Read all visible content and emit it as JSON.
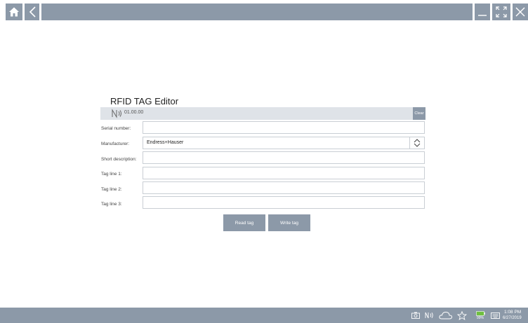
{
  "app": {
    "title": "RFID TAG Editor"
  },
  "header": {
    "version": "01.00.00",
    "clear_label": "Clear"
  },
  "form": {
    "fields": [
      {
        "label": "Serial number:",
        "value": ""
      },
      {
        "label": "Manufacturer:",
        "value": "Endress+Hauser"
      },
      {
        "label": "Short description:",
        "value": ""
      },
      {
        "label": "Tag line 1:",
        "value": ""
      },
      {
        "label": "Tag line 2:",
        "value": ""
      },
      {
        "label": "Tag line 3:",
        "value": ""
      }
    ]
  },
  "actions": {
    "read_label": "Read tag",
    "write_label": "Write tag"
  },
  "taskbar": {
    "battery": "99%",
    "time": "1:08 PM",
    "date": "6/27/2019"
  },
  "icons": {
    "top": [
      "home-icon",
      "back-icon",
      "minimize-icon",
      "fullscreen-icon",
      "close-icon"
    ],
    "tray": [
      "camera-icon",
      "nfc-icon",
      "cloud-icon",
      "star-icon",
      "battery-icon",
      "keyboard-icon"
    ]
  },
  "colors": {
    "accent": "#8c99a8",
    "header_bg": "#dfe3e8",
    "field_border": "#c9ced4"
  }
}
